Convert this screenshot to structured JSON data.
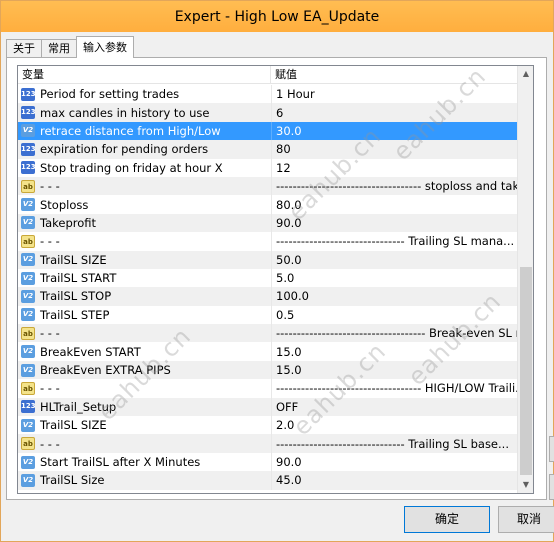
{
  "window": {
    "title": "Expert - High Low EA_Update"
  },
  "tabs": [
    {
      "label": "关于",
      "active": false
    },
    {
      "label": "常用",
      "active": false
    },
    {
      "label": "输入参数",
      "active": true
    }
  ],
  "table": {
    "headers": {
      "variable": "变量",
      "value": "赋值"
    },
    "rows": [
      {
        "icon": "int",
        "name": "Period for setting trades",
        "value": "1 Hour"
      },
      {
        "icon": "int",
        "name": "max candles in history to use",
        "value": "6"
      },
      {
        "icon": "dbl",
        "name": "retrace distance from High/Low",
        "value": "30.0",
        "selected": true
      },
      {
        "icon": "int",
        "name": "expiration for pending orders",
        "value": "80"
      },
      {
        "icon": "int",
        "name": "Stop trading on friday at hour X",
        "value": "12"
      },
      {
        "icon": "str",
        "name": "- - -",
        "value": "----------------------------------- stoploss and tak..."
      },
      {
        "icon": "dbl",
        "name": "Stoploss",
        "value": "80.0"
      },
      {
        "icon": "dbl",
        "name": "Takeprofit",
        "value": "90.0"
      },
      {
        "icon": "str",
        "name": "- - -",
        "value": "------------------------------- Trailing SL mana..."
      },
      {
        "icon": "dbl",
        "name": "TrailSL SIZE",
        "value": "50.0"
      },
      {
        "icon": "dbl",
        "name": "TrailSL START",
        "value": "5.0"
      },
      {
        "icon": "dbl",
        "name": "TrailSL STOP",
        "value": "100.0"
      },
      {
        "icon": "dbl",
        "name": "TrailSL STEP",
        "value": "0.5"
      },
      {
        "icon": "str",
        "name": "- - -",
        "value": "------------------------------------ Break-even SL m..."
      },
      {
        "icon": "dbl",
        "name": "BreakEven START",
        "value": "15.0"
      },
      {
        "icon": "dbl",
        "name": "BreakEven EXTRA PIPS",
        "value": "15.0"
      },
      {
        "icon": "str",
        "name": "- - -",
        "value": "----------------------------------- HIGH/LOW Traili..."
      },
      {
        "icon": "enum",
        "name": "HLTrail_Setup",
        "value": "OFF"
      },
      {
        "icon": "dbl",
        "name": "TrailSL SIZE",
        "value": "2.0"
      },
      {
        "icon": "str",
        "name": "- - -",
        "value": "------------------------------- Trailing SL base..."
      },
      {
        "icon": "dbl",
        "name": "Start TrailSL after X Minutes",
        "value": "90.0"
      },
      {
        "icon": "dbl",
        "name": "TrailSL Size",
        "value": "45.0"
      }
    ]
  },
  "icons": {
    "int": "123",
    "dbl": "V2",
    "str": "ab",
    "enum": "123"
  },
  "buttons": {
    "ok": "确定",
    "cancel": "取消"
  },
  "watermark": "eahub.cn",
  "colors": {
    "title_bar": "#ffb347",
    "selection": "#3399ff"
  }
}
